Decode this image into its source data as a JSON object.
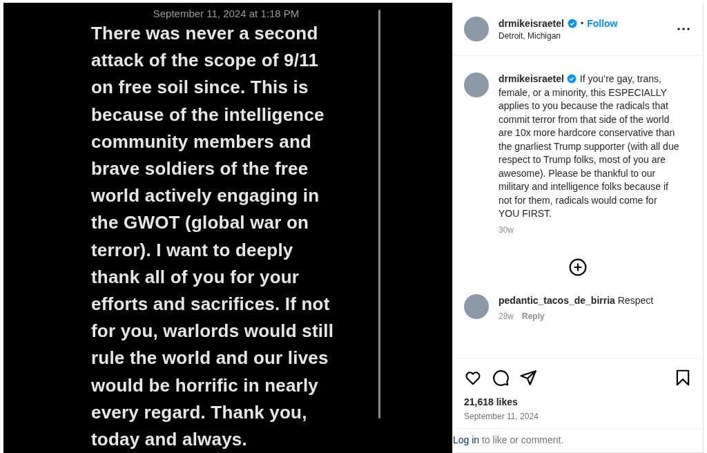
{
  "note": {
    "timestamp": "September 11, 2024 at 1:18 PM",
    "lines": [
      "There was never a second",
      "attack of the scope of 9/11",
      "on free soil since. This is",
      "because of the intelligence",
      "community members and",
      "brave soldiers of the free",
      "world actively engaging in",
      "the GWOT (global war on",
      "terror). I want to deeply",
      "thank all of you for your",
      "efforts and sacrifices. If not",
      "for you, warlords would still",
      "rule the world and our lives",
      "would be horrific in nearly",
      "every regard. Thank you,",
      "today and always."
    ]
  },
  "header": {
    "username": "drmikeisraetel",
    "verified": true,
    "separator": "•",
    "follow": "Follow",
    "location": "Detroit, Michigan"
  },
  "caption": {
    "username": "drmikeisraetel",
    "verified": true,
    "text": "If you’re gay, trans, female, or a minority, this ESPECIALLY applies to you because the radicals that commit terror from that side of the world are 10x more hardcore conservative than the gnarliest Trump supporter (with all due respect to Trump folks, most of you are awesome). Please be thankful to our military and intelligence folks because if not for them, radicals would come for YOU FIRST.",
    "age": "30w"
  },
  "comments": [
    {
      "username": "pedantic_tacos_de_birria",
      "text": "Respect",
      "age": "28w",
      "reply": "Reply"
    }
  ],
  "likes": "21,618 likes",
  "date": "September 11, 2024",
  "login": {
    "link": "Log in",
    "text": "to like or comment."
  }
}
